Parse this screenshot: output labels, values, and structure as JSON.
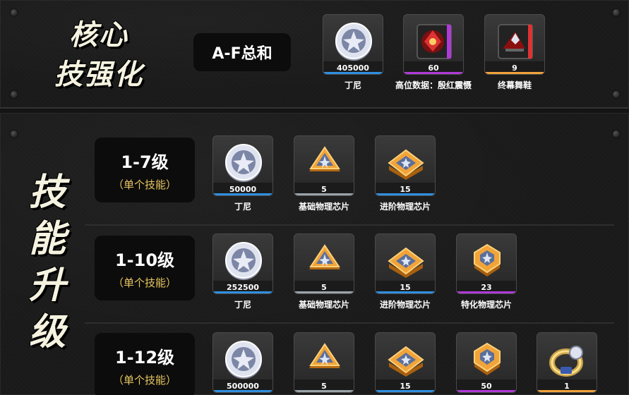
{
  "core": {
    "title_line1": "核心",
    "title_line2": "技强化",
    "af_label": "A-F总和",
    "items": [
      {
        "icon": "coin-icon",
        "count": "405000",
        "name": "丁尼",
        "color": "#2f8fe0"
      },
      {
        "icon": "crimson-data-icon",
        "count": "60",
        "name": "高位数据：殷红震慑",
        "color": "#b03ad8"
      },
      {
        "icon": "finale-shoe-icon",
        "count": "9",
        "name": "终幕舞鞋",
        "color": "#f0a23a"
      }
    ]
  },
  "skill": {
    "title": [
      "技",
      "能",
      "升",
      "级"
    ],
    "rows": [
      {
        "level": "1-7级",
        "sub": "（单个技能）",
        "items": [
          {
            "icon": "coin-icon",
            "count": "50000",
            "name": "丁尼",
            "color": "#2f8fe0"
          },
          {
            "icon": "basic-chip-icon",
            "count": "5",
            "name": "基础物理芯片",
            "color": "#9aa3a8"
          },
          {
            "icon": "advanced-chip-icon",
            "count": "15",
            "name": "进阶物理芯片",
            "color": "#2f8fe0"
          }
        ]
      },
      {
        "level": "1-10级",
        "sub": "（单个技能）",
        "items": [
          {
            "icon": "coin-icon",
            "count": "252500",
            "name": "丁尼",
            "color": "#2f8fe0"
          },
          {
            "icon": "basic-chip-icon",
            "count": "5",
            "name": "基础物理芯片",
            "color": "#9aa3a8"
          },
          {
            "icon": "advanced-chip-icon",
            "count": "15",
            "name": "进阶物理芯片",
            "color": "#2f8fe0"
          },
          {
            "icon": "special-chip-icon",
            "count": "23",
            "name": "特化物理芯片",
            "color": "#b03ad8"
          }
        ]
      },
      {
        "level": "1-12级",
        "sub": "（单个技能）",
        "items": [
          {
            "icon": "coin-icon",
            "count": "500000",
            "name": "",
            "color": "#2f8fe0"
          },
          {
            "icon": "basic-chip-icon",
            "count": "5",
            "name": "",
            "color": "#9aa3a8"
          },
          {
            "icon": "advanced-chip-icon",
            "count": "15",
            "name": "",
            "color": "#2f8fe0"
          },
          {
            "icon": "special-chip-icon",
            "count": "50",
            "name": "",
            "color": "#b03ad8"
          },
          {
            "icon": "gold-ring-icon",
            "count": "1",
            "name": "",
            "color": "#f0a23a"
          }
        ]
      }
    ]
  }
}
